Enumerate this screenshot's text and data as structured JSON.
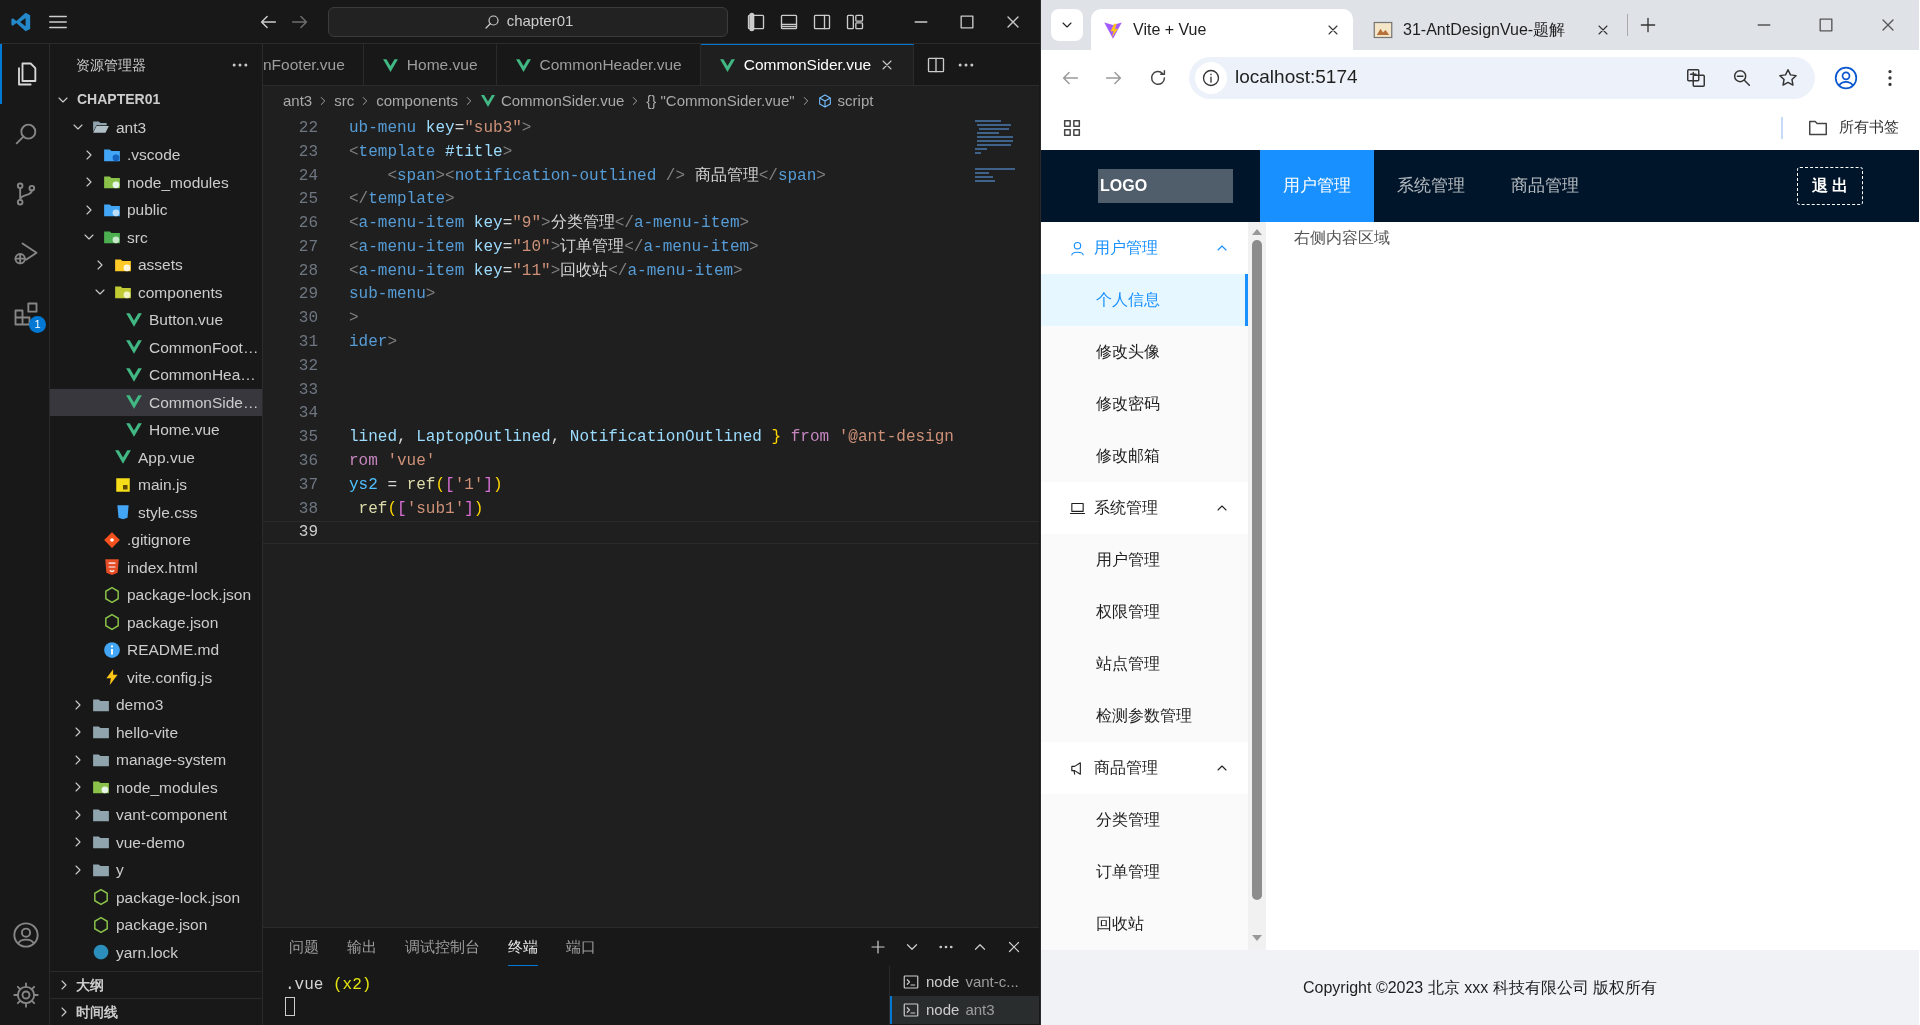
{
  "vscode": {
    "title_bar": {
      "search": "chapter01"
    },
    "activity_bar": [
      {
        "kind": "files",
        "selected": true
      },
      {
        "kind": "search",
        "selected": false
      },
      {
        "kind": "source-control",
        "selected": false
      },
      {
        "kind": "run-debug",
        "selected": false
      },
      {
        "kind": "extensions",
        "selected": false,
        "badge": "1"
      }
    ],
    "activity_bar_bottom": [
      {
        "kind": "account"
      },
      {
        "kind": "settings"
      }
    ],
    "explorer": {
      "title": "资源管理器",
      "root": {
        "label": "CHAPTER01",
        "expanded": true
      },
      "tree": [
        {
          "name": "ant3",
          "kind": "folder-open",
          "expanded": true,
          "selected": false,
          "children": [
            {
              "name": ".vscode",
              "kind": "folder-vscode",
              "expanded": false,
              "selected": false
            },
            {
              "name": "node_modules",
              "kind": "folder-node",
              "expanded": false,
              "selected": false
            },
            {
              "name": "public",
              "kind": "folder-public",
              "expanded": false,
              "selected": false
            },
            {
              "name": "src",
              "kind": "folder-src",
              "expanded": true,
              "selected": false,
              "children": [
                {
                  "name": "assets",
                  "kind": "folder-assets",
                  "expanded": false,
                  "selected": false
                },
                {
                  "name": "components",
                  "kind": "folder-components",
                  "expanded": true,
                  "selected": false,
                  "children": [
                    {
                      "name": "Button.vue",
                      "kind": "vue",
                      "selected": false
                    },
                    {
                      "name": "CommonFoot…",
                      "kind": "vue",
                      "selected": false
                    },
                    {
                      "name": "CommonHea…",
                      "kind": "vue",
                      "selected": false
                    },
                    {
                      "name": "CommonSide…",
                      "kind": "vue",
                      "selected": true
                    },
                    {
                      "name": "Home.vue",
                      "kind": "vue",
                      "selected": false
                    }
                  ]
                },
                {
                  "name": "App.vue",
                  "kind": "vue",
                  "selected": false
                },
                {
                  "name": "main.js",
                  "kind": "js",
                  "selected": false
                },
                {
                  "name": "style.css",
                  "kind": "css",
                  "selected": false
                }
              ]
            },
            {
              "name": ".gitignore",
              "kind": "git",
              "selected": false
            },
            {
              "name": "index.html",
              "kind": "html",
              "selected": false
            },
            {
              "name": "package-lock.json",
              "kind": "json",
              "selected": false
            },
            {
              "name": "package.json",
              "kind": "json",
              "selected": false
            },
            {
              "name": "README.md",
              "kind": "info",
              "selected": false
            },
            {
              "name": "vite.config.js",
              "kind": "vite",
              "selected": false
            }
          ]
        },
        {
          "name": "demo3",
          "kind": "folder",
          "expanded": false,
          "selected": false
        },
        {
          "name": "hello-vite",
          "kind": "folder",
          "expanded": false,
          "selected": false
        },
        {
          "name": "manage-system",
          "kind": "folder",
          "expanded": false,
          "selected": false
        },
        {
          "name": "node_modules",
          "kind": "folder-node",
          "expanded": false,
          "selected": false
        },
        {
          "name": "vant-component",
          "kind": "folder",
          "expanded": false,
          "selected": false
        },
        {
          "name": "vue-demo",
          "kind": "folder",
          "expanded": false,
          "selected": false
        },
        {
          "name": "y",
          "kind": "folder",
          "expanded": false,
          "selected": false
        },
        {
          "name": "package-lock.json",
          "kind": "json",
          "selected": false
        },
        {
          "name": "package.json",
          "kind": "json",
          "selected": false
        },
        {
          "name": "yarn.lock",
          "kind": "yarn",
          "selected": false
        }
      ],
      "sections": [
        {
          "label": "大纲",
          "expanded": false
        },
        {
          "label": "时间线",
          "expanded": false
        }
      ]
    },
    "editor": {
      "tabs": [
        {
          "label": "nFooter.vue",
          "selected": false
        },
        {
          "label": "Home.vue",
          "kind": "vue",
          "selected": false
        },
        {
          "label": "CommonHeader.vue",
          "kind": "vue",
          "selected": false
        },
        {
          "label": "CommonSider.vue",
          "kind": "vue",
          "selected": true
        }
      ],
      "breadcrumb": [
        {
          "label": "ant3"
        },
        {
          "label": "src"
        },
        {
          "label": "components"
        },
        {
          "label": "CommonSider.vue",
          "kind": "vue"
        },
        {
          "label": "{} \"CommonSider.vue\""
        },
        {
          "label": "script",
          "kind": "cube"
        }
      ],
      "lines": [
        {
          "number": "22",
          "selected": false,
          "segments": [
            {
              "kind": "tag",
              "text": "ub-menu"
            },
            {
              "kind": "attr",
              "text": " key"
            },
            {
              "kind": "text",
              "text": "="
            },
            {
              "kind": "str",
              "text": "\"sub3\""
            },
            {
              "kind": "punct",
              "text": ">"
            }
          ]
        },
        {
          "number": "23",
          "selected": false,
          "segments": [
            {
              "kind": "punct",
              "text": "<"
            },
            {
              "kind": "tag",
              "text": "template"
            },
            {
              "kind": "attr",
              "text": " #title"
            },
            {
              "kind": "punct",
              "text": ">"
            }
          ]
        },
        {
          "number": "24",
          "selected": false,
          "segments": [
            {
              "kind": "punct",
              "text": "    <"
            },
            {
              "kind": "tag",
              "text": "span"
            },
            {
              "kind": "punct",
              "text": "><"
            },
            {
              "kind": "tag",
              "text": "notification-outlined"
            },
            {
              "kind": "punct",
              "text": " />"
            },
            {
              "kind": "text",
              "text": " 商品管理"
            },
            {
              "kind": "punct",
              "text": "</"
            },
            {
              "kind": "tag",
              "text": "span"
            },
            {
              "kind": "punct",
              "text": ">"
            }
          ]
        },
        {
          "number": "25",
          "selected": false,
          "segments": [
            {
              "kind": "punct",
              "text": "</"
            },
            {
              "kind": "tag",
              "text": "template"
            },
            {
              "kind": "punct",
              "text": ">"
            }
          ]
        },
        {
          "number": "26",
          "selected": false,
          "segments": [
            {
              "kind": "punct",
              "text": "<"
            },
            {
              "kind": "tag",
              "text": "a-menu-item"
            },
            {
              "kind": "attr",
              "text": " key"
            },
            {
              "kind": "text",
              "text": "="
            },
            {
              "kind": "str",
              "text": "\"9\""
            },
            {
              "kind": "punct",
              "text": ">"
            },
            {
              "kind": "text",
              "text": "分类管理"
            },
            {
              "kind": "punct",
              "text": "</"
            },
            {
              "kind": "tag",
              "text": "a-menu-item"
            },
            {
              "kind": "punct",
              "text": ">"
            }
          ]
        },
        {
          "number": "27",
          "selected": false,
          "segments": [
            {
              "kind": "punct",
              "text": "<"
            },
            {
              "kind": "tag",
              "text": "a-menu-item"
            },
            {
              "kind": "attr",
              "text": " key"
            },
            {
              "kind": "text",
              "text": "="
            },
            {
              "kind": "str",
              "text": "\"10\""
            },
            {
              "kind": "punct",
              "text": ">"
            },
            {
              "kind": "text",
              "text": "订单管理"
            },
            {
              "kind": "punct",
              "text": "</"
            },
            {
              "kind": "tag",
              "text": "a-menu-item"
            },
            {
              "kind": "punct",
              "text": ">"
            }
          ]
        },
        {
          "number": "28",
          "selected": false,
          "segments": [
            {
              "kind": "punct",
              "text": "<"
            },
            {
              "kind": "tag",
              "text": "a-menu-item"
            },
            {
              "kind": "attr",
              "text": " key"
            },
            {
              "kind": "text",
              "text": "="
            },
            {
              "kind": "str",
              "text": "\"11\""
            },
            {
              "kind": "punct",
              "text": ">"
            },
            {
              "kind": "text",
              "text": "回收站"
            },
            {
              "kind": "punct",
              "text": "</"
            },
            {
              "kind": "tag",
              "text": "a-menu-item"
            },
            {
              "kind": "punct",
              "text": ">"
            }
          ]
        },
        {
          "number": "29",
          "selected": false,
          "segments": [
            {
              "kind": "tag",
              "text": "sub-menu"
            },
            {
              "kind": "punct",
              "text": ">"
            }
          ]
        },
        {
          "number": "30",
          "selected": false,
          "segments": [
            {
              "kind": "punct",
              "text": ">"
            }
          ]
        },
        {
          "number": "31",
          "selected": false,
          "segments": [
            {
              "kind": "tag",
              "text": "ider"
            },
            {
              "kind": "punct",
              "text": ">"
            }
          ]
        },
        {
          "number": "32",
          "selected": false
        },
        {
          "number": "33",
          "selected": false
        },
        {
          "number": "34",
          "selected": false
        },
        {
          "number": "35",
          "selected": false,
          "segments": [
            {
              "kind": "ident",
              "text": "lined"
            },
            {
              "kind": "text",
              "text": ", "
            },
            {
              "kind": "ident",
              "text": "LaptopOutlined"
            },
            {
              "kind": "text",
              "text": ", "
            },
            {
              "kind": "ident",
              "text": "NotificationOutlined"
            },
            {
              "kind": "brace",
              "text": " }"
            },
            {
              "kind": "kw",
              "text": " from"
            },
            {
              "kind": "str",
              "text": " '@ant-design"
            }
          ]
        },
        {
          "number": "36",
          "selected": false,
          "segments": [
            {
              "kind": "kw",
              "text": "rom"
            },
            {
              "kind": "str",
              "text": " 'vue'"
            }
          ]
        },
        {
          "number": "37",
          "selected": false,
          "segments": [
            {
              "kind": "var",
              "text": "ys2"
            },
            {
              "kind": "text",
              "text": " = "
            },
            {
              "kind": "func",
              "text": "ref"
            },
            {
              "kind": "brace",
              "text": "("
            },
            {
              "kind": "bracket",
              "text": "["
            },
            {
              "kind": "str",
              "text": "'1'"
            },
            {
              "kind": "bracket",
              "text": "]"
            },
            {
              "kind": "brace",
              "text": ")"
            }
          ]
        },
        {
          "number": "38",
          "selected": false,
          "segments": [
            {
              "kind": "func",
              "text": " ref"
            },
            {
              "kind": "brace",
              "text": "("
            },
            {
              "kind": "bracket",
              "text": "["
            },
            {
              "kind": "str",
              "text": "'sub1'"
            },
            {
              "kind": "bracket",
              "text": "]"
            },
            {
              "kind": "brace",
              "text": ")"
            }
          ]
        },
        {
          "number": "39",
          "selected": true
        }
      ]
    },
    "panel": {
      "tabs": [
        {
          "label": "问题",
          "selected": false
        },
        {
          "label": "输出",
          "selected": false
        },
        {
          "label": "调试控制台",
          "selected": false
        },
        {
          "label": "终端",
          "selected": true
        },
        {
          "label": "端口",
          "selected": false
        }
      ],
      "terminal": [
        {
          "segments": [
            {
              "kind": "text",
              "text": ".vue "
            },
            {
              "kind": "yellow",
              "text": "(x2)"
            }
          ]
        },
        {
          "cursor": true
        }
      ],
      "terminals": [
        {
          "name": "node",
          "detail": "vant-c...",
          "selected": false
        },
        {
          "name": "node",
          "detail": "ant3",
          "selected": true
        }
      ]
    }
  },
  "browser": {
    "tabs": [
      {
        "title": "Vite + Vue",
        "kind": "vite",
        "selected": true
      },
      {
        "title": "31-AntDesignVue-题解",
        "kind": "image",
        "selected": false
      }
    ],
    "url": "localhost:5174",
    "bookmarks": [
      {
        "label": "所有书签"
      }
    ],
    "app": {
      "logo": "LOGO",
      "nav": [
        {
          "label": "用户管理",
          "selected": true
        },
        {
          "label": "系统管理",
          "selected": false
        },
        {
          "label": "商品管理",
          "selected": false
        }
      ],
      "logout": "退 出",
      "menu": [
        {
          "label": "用户管理",
          "kind": "user",
          "expanded": true,
          "children": [
            {
              "label": "个人信息",
              "selected": true
            },
            {
              "label": "修改头像",
              "selected": false
            },
            {
              "label": "修改密码",
              "selected": false
            },
            {
              "label": "修改邮箱",
              "selected": false
            }
          ]
        },
        {
          "label": "系统管理",
          "kind": "laptop",
          "expanded": true,
          "children": [
            {
              "label": "用户管理",
              "selected": false
            },
            {
              "label": "权限管理",
              "selected": false
            },
            {
              "label": "站点管理",
              "selected": false
            },
            {
              "label": "检测参数管理",
              "selected": false
            }
          ]
        },
        {
          "label": "商品管理",
          "kind": "notification",
          "expanded": true,
          "children": [
            {
              "label": "分类管理",
              "selected": false
            },
            {
              "label": "订单管理",
              "selected": false
            },
            {
              "label": "回收站",
              "selected": false
            }
          ]
        }
      ],
      "content": "右侧内容区域",
      "footer": "Copyright ©2023 北京 xxx 科技有限公司 版权所有"
    }
  }
}
